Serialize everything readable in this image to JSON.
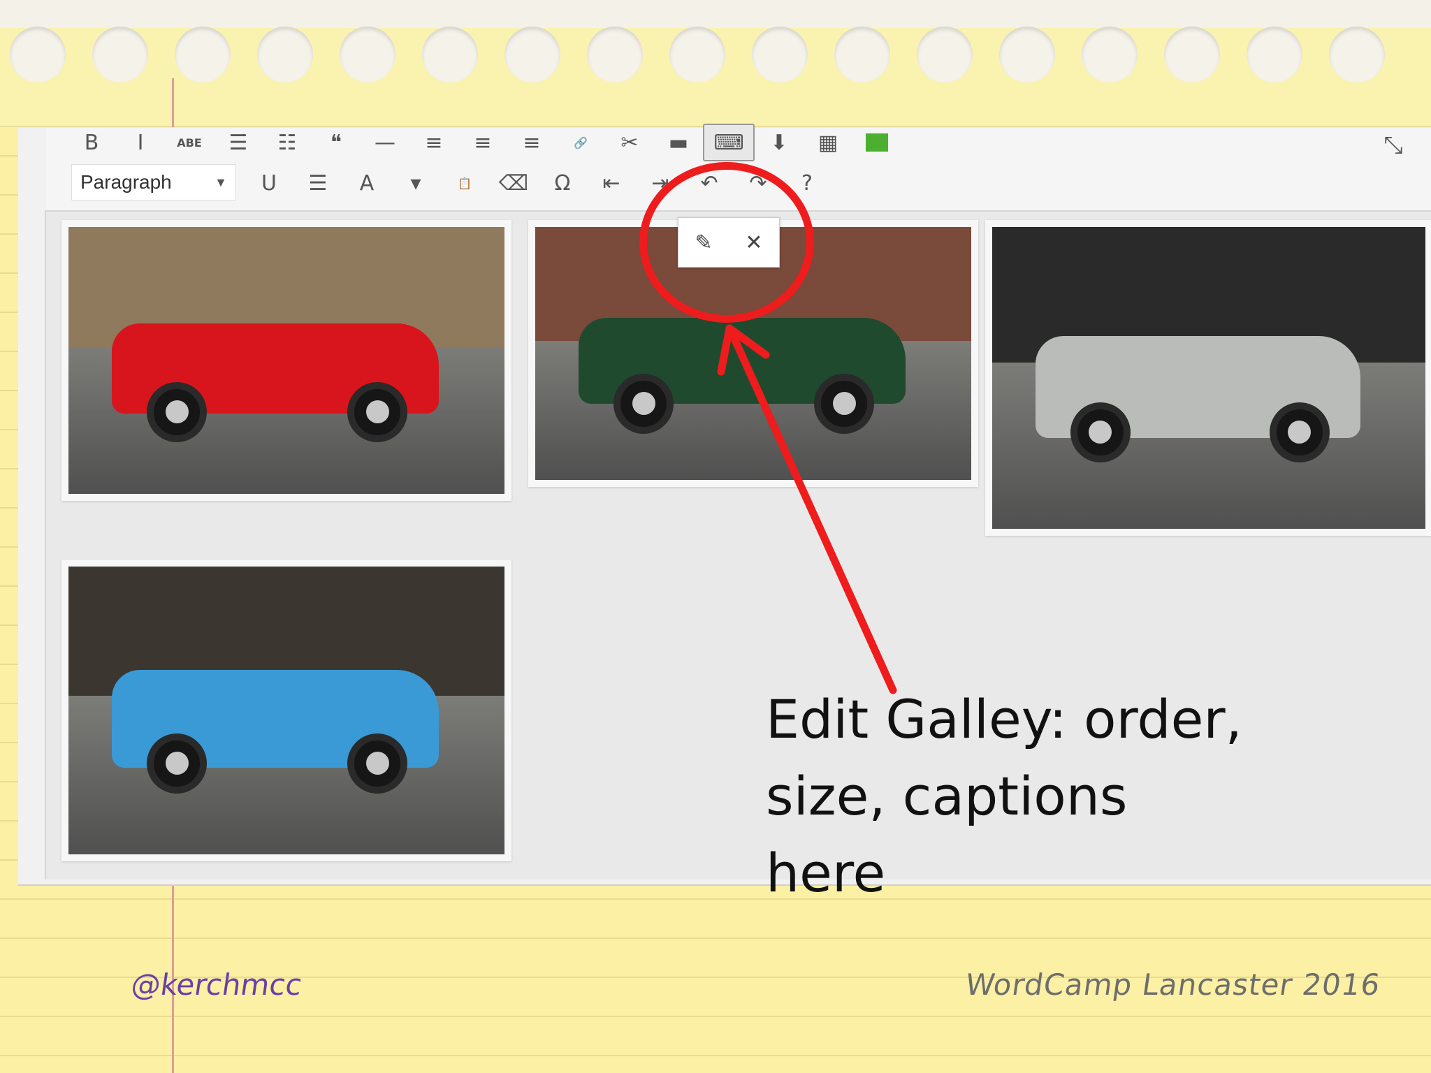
{
  "toolbar": {
    "row1": [
      {
        "name": "bold-icon",
        "glyph": "B"
      },
      {
        "name": "italic-icon",
        "glyph": "I"
      },
      {
        "name": "strikethrough-icon",
        "glyph": "ABE"
      },
      {
        "name": "bulleted-list-icon",
        "glyph": "☰"
      },
      {
        "name": "numbered-list-icon",
        "glyph": "☷"
      },
      {
        "name": "blockquote-icon",
        "glyph": "❝"
      },
      {
        "name": "horizontal-line-icon",
        "glyph": "—"
      },
      {
        "name": "align-left-icon",
        "glyph": "≡"
      },
      {
        "name": "align-center-icon",
        "glyph": "≡"
      },
      {
        "name": "align-right-icon",
        "glyph": "≡"
      },
      {
        "name": "insert-link-icon",
        "glyph": "🔗"
      },
      {
        "name": "remove-link-icon",
        "glyph": "✂"
      },
      {
        "name": "read-more-icon",
        "glyph": "▬"
      },
      {
        "name": "toolbar-toggle-icon",
        "glyph": "⌨"
      },
      {
        "name": "upload-icon",
        "glyph": "⬇"
      },
      {
        "name": "calendar-icon",
        "glyph": "▦"
      }
    ],
    "paragraph_label": "Paragraph",
    "row2": [
      {
        "name": "underline-icon",
        "glyph": "U"
      },
      {
        "name": "justify-icon",
        "glyph": "☰"
      },
      {
        "name": "text-color-icon",
        "glyph": "A"
      },
      {
        "name": "text-color-dropdown-icon",
        "glyph": "▾"
      },
      {
        "name": "paste-as-text-icon",
        "glyph": "📋"
      },
      {
        "name": "clear-formatting-icon",
        "glyph": "⌫"
      },
      {
        "name": "special-character-icon",
        "glyph": "Ω"
      },
      {
        "name": "outdent-icon",
        "glyph": "⇤"
      },
      {
        "name": "indent-icon",
        "glyph": "⇥"
      },
      {
        "name": "undo-icon",
        "glyph": "↶"
      },
      {
        "name": "redo-icon",
        "glyph": "↷"
      },
      {
        "name": "help-icon",
        "glyph": "?"
      }
    ],
    "fullscreen_glyph": "⤡"
  },
  "gallery_toolbar": {
    "edit_glyph": "✎",
    "remove_glyph": "✕"
  },
  "gallery": {
    "images": [
      {
        "name": "gallery-image-red-car",
        "body": "#d8151c",
        "bg": "#8f7a5e"
      },
      {
        "name": "gallery-image-green-cars",
        "body": "#1f4a2e",
        "bg": "#7a4a3a"
      },
      {
        "name": "gallery-image-silver-car",
        "body": "#b9bcb8",
        "bg": "#2a2a2a"
      },
      {
        "name": "gallery-image-blue-van",
        "body": "#3a9ad6",
        "bg": "#3c3630"
      }
    ]
  },
  "annotation": {
    "line1": "Edit Galley: order,",
    "line2": "size, captions here"
  },
  "footer": {
    "handle": "@kerchmcc",
    "event": "WordCamp Lancaster 2016"
  },
  "colors": {
    "annotation_red": "#ee1c1c",
    "handle_purple": "#6b3fa8",
    "paper_yellow": "#fbf0a3"
  }
}
